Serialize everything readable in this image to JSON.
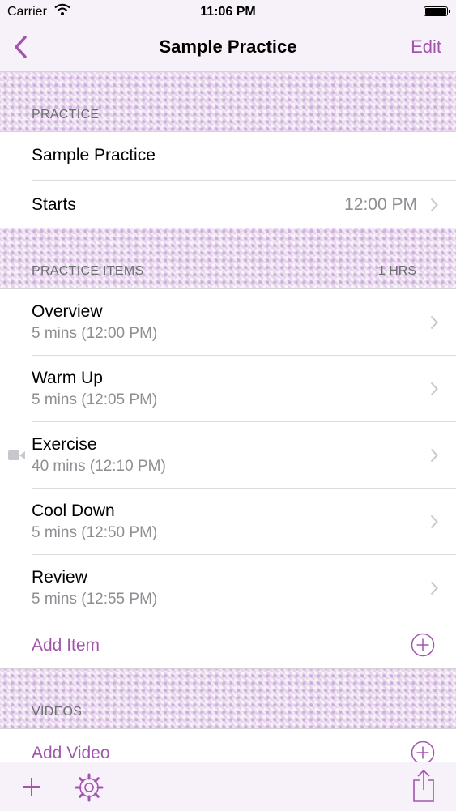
{
  "status_bar": {
    "carrier": "Carrier",
    "time": "11:06 PM"
  },
  "nav": {
    "title": "Sample Practice",
    "edit_label": "Edit"
  },
  "practice_section": {
    "header": "PRACTICE",
    "name": "Sample Practice",
    "starts_label": "Starts",
    "starts_value": "12:00 PM"
  },
  "items_section": {
    "header": "PRACTICE ITEMS",
    "total": "1 HRS",
    "items": [
      {
        "title": "Overview",
        "detail": "5 mins (12:00 PM)"
      },
      {
        "title": "Warm Up",
        "detail": "5 mins (12:05 PM)"
      },
      {
        "title": "Exercise",
        "detail": "40 mins (12:10 PM)"
      },
      {
        "title": "Cool Down",
        "detail": "5 mins (12:50 PM)"
      },
      {
        "title": "Review",
        "detail": "5 mins (12:55 PM)"
      }
    ],
    "add_label": "Add Item"
  },
  "videos_section": {
    "header": "VIDEOS",
    "add_label": "Add Video"
  },
  "colors": {
    "accent": "#a355ae",
    "secondary_text": "#8e8e93",
    "header_text": "#6d6d72"
  },
  "icons": {
    "back": "chevron-left-icon",
    "chevron": "chevron-right-icon",
    "add": "plus-circle-icon",
    "video": "video-camera-icon",
    "toolbar_add": "plus-icon",
    "settings": "gear-icon",
    "share": "share-icon"
  }
}
